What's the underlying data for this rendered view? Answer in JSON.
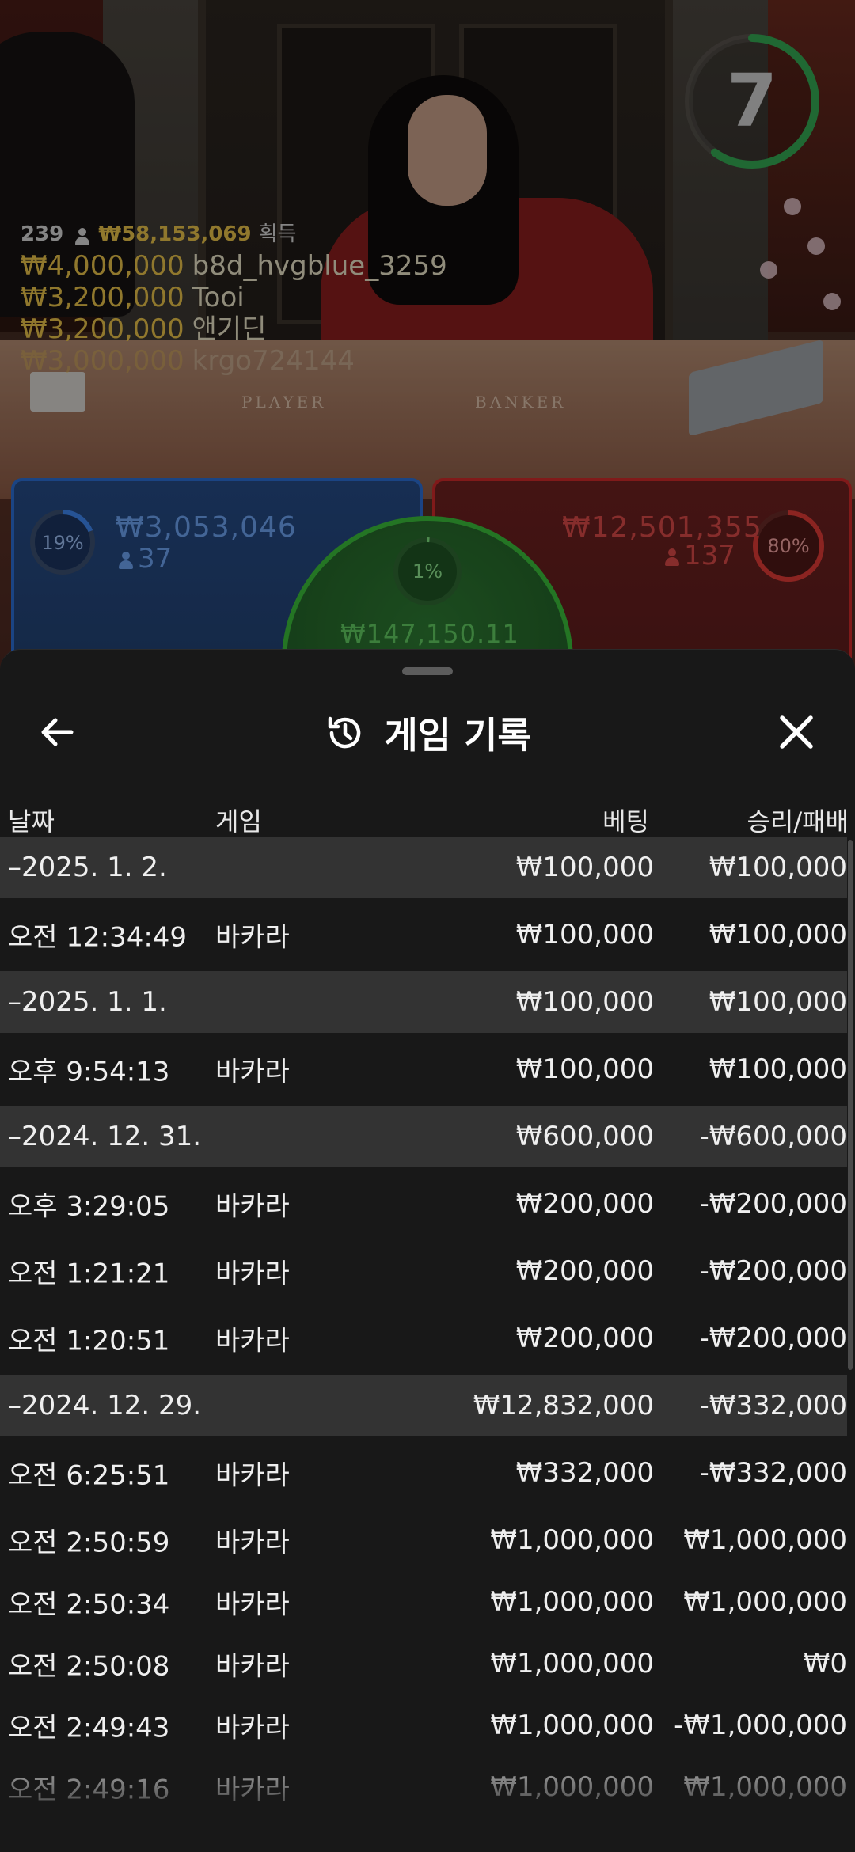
{
  "live": {
    "timer": "7",
    "timer_fraction": 0.6,
    "ticker": {
      "players": "239",
      "total": "₩58,153,069",
      "label": "획득",
      "rows": [
        {
          "amount": "₩4,000,000",
          "name": "b8d_hvgblue_3259"
        },
        {
          "amount": "₩3,200,000",
          "name": "Tooi"
        },
        {
          "amount": "₩3,200,000",
          "name": "앤기딘"
        },
        {
          "amount": "₩3,000,000",
          "name": "krgo724144"
        }
      ]
    },
    "table_labels": {
      "player": "PLAYER",
      "banker": "BANKER"
    },
    "player": {
      "percent": "19%",
      "percent_value": 0.19,
      "amount": "₩3,053,046",
      "count": "37"
    },
    "tie": {
      "percent": "1%",
      "percent_value": 0.01,
      "amount": "₩147,150.11"
    },
    "banker": {
      "percent": "80%",
      "percent_value": 0.8,
      "amount": "₩12,501,355",
      "count": "137"
    },
    "colors": {
      "player": "#2d6fd3",
      "banker": "#cf2b2b",
      "tie": "#3bbd3b",
      "gold": "#e9c24a"
    }
  },
  "history": {
    "title": "게임 기록",
    "icons": {
      "back": "arrow-left-icon",
      "title": "history-clock-icon",
      "close": "close-x-icon"
    },
    "columns": {
      "date": "날짜",
      "game": "게임",
      "bet": "베팅",
      "result": "승리/패배"
    },
    "rows": [
      {
        "type": "date",
        "date": "–2025. 1. 2.",
        "bet": "₩100,000",
        "result": "₩100,000"
      },
      {
        "type": "game",
        "time": "오전 12:34:49",
        "game": "바카라",
        "bet": "₩100,000",
        "result": "₩100,000"
      },
      {
        "type": "date",
        "date": "–2025. 1. 1.",
        "bet": "₩100,000",
        "result": "₩100,000"
      },
      {
        "type": "game",
        "time": "오후 9:54:13",
        "game": "바카라",
        "bet": "₩100,000",
        "result": "₩100,000"
      },
      {
        "type": "date",
        "date": "–2024. 12. 31.",
        "bet": "₩600,000",
        "result": "-₩600,000"
      },
      {
        "type": "game",
        "time": "오후 3:29:05",
        "game": "바카라",
        "bet": "₩200,000",
        "result": "-₩200,000"
      },
      {
        "type": "game",
        "time": "오전 1:21:21",
        "game": "바카라",
        "bet": "₩200,000",
        "result": "-₩200,000"
      },
      {
        "type": "game",
        "time": "오전 1:20:51",
        "game": "바카라",
        "bet": "₩200,000",
        "result": "-₩200,000"
      },
      {
        "type": "date",
        "date": "–2024. 12. 29.",
        "bet": "₩12,832,000",
        "result": "-₩332,000"
      },
      {
        "type": "game",
        "time": "오전 6:25:51",
        "game": "바카라",
        "bet": "₩332,000",
        "result": "-₩332,000"
      },
      {
        "type": "game",
        "time": "오전 2:50:59",
        "game": "바카라",
        "bet": "₩1,000,000",
        "result": "₩1,000,000"
      },
      {
        "type": "game",
        "time": "오전 2:50:34",
        "game": "바카라",
        "bet": "₩1,000,000",
        "result": "₩1,000,000"
      },
      {
        "type": "game",
        "time": "오전 2:50:08",
        "game": "바카라",
        "bet": "₩1,000,000",
        "result": "₩0"
      },
      {
        "type": "game",
        "time": "오전 2:49:43",
        "game": "바카라",
        "bet": "₩1,000,000",
        "result": "-₩1,000,000"
      },
      {
        "type": "game",
        "time": "오전 2:49:16",
        "game": "바카라",
        "bet": "₩1,000,000",
        "result": "₩1,000,000"
      }
    ]
  }
}
